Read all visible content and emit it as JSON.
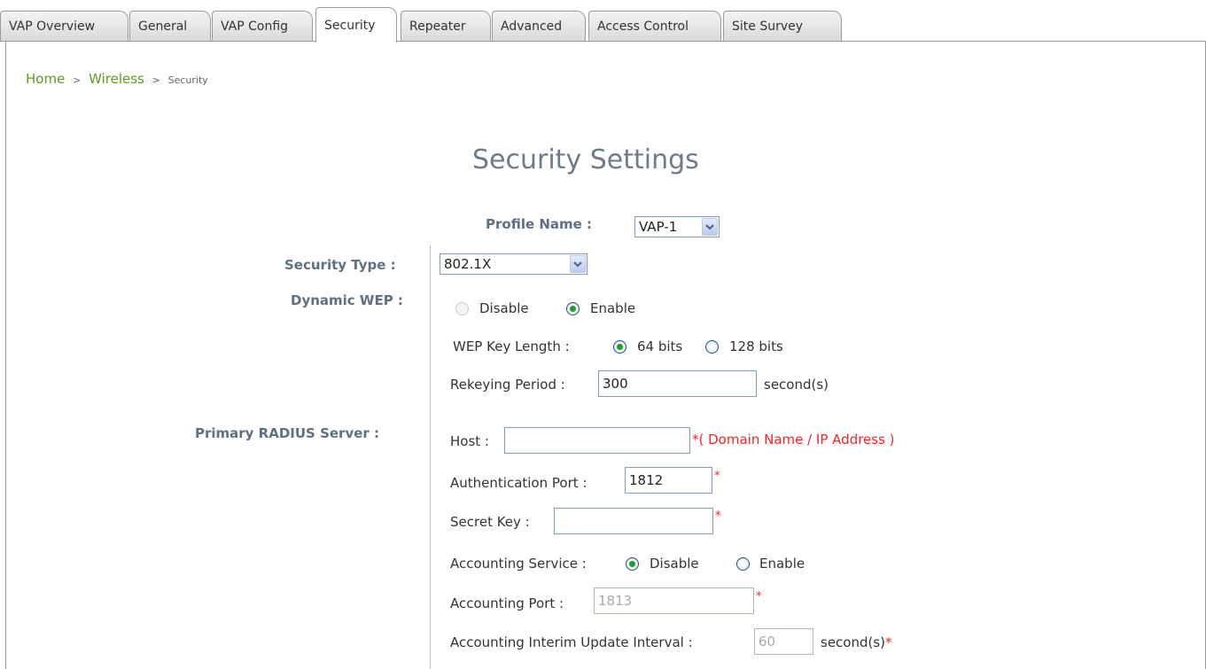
{
  "tabs": [
    {
      "label": "VAP Overview"
    },
    {
      "label": "General"
    },
    {
      "label": "VAP Config"
    },
    {
      "label": "Security"
    },
    {
      "label": "Repeater"
    },
    {
      "label": "Advanced"
    },
    {
      "label": "Access Control"
    },
    {
      "label": "Site Survey"
    }
  ],
  "breadcrumb": {
    "home": "Home",
    "sep": ">",
    "wireless": "Wireless",
    "current": "Security"
  },
  "page": {
    "title": "Security Settings"
  },
  "profile": {
    "label": "Profile Name :",
    "value": "VAP-1"
  },
  "security_type": {
    "label": "Security Type :",
    "value": "802.1X"
  },
  "dynamic_wep": {
    "label": "Dynamic WEP :",
    "disable": "Disable",
    "enable": "Enable",
    "selected": "Enable",
    "key_length_label": "WEP Key Length :",
    "key_64": "64 bits",
    "key_128": "128 bits",
    "key_selected": "64 bits",
    "rekey_label": "Rekeying Period :",
    "rekey_value": "300",
    "rekey_unit": "second(s)"
  },
  "radius": {
    "label": "Primary RADIUS Server :",
    "host_label": "Host :",
    "host_value": "",
    "required": "*",
    "host_hint": "( Domain Name / IP Address )",
    "auth_port_label": "Authentication Port :",
    "auth_port_value": "1812",
    "secret_label": "Secret Key :",
    "secret_value": "",
    "acct_service_label": "Accounting Service :",
    "acct_disable": "Disable",
    "acct_enable": "Enable",
    "acct_selected": "Disable",
    "acct_port_label": "Accounting Port :",
    "acct_port_value": "1813",
    "interim_label": "Accounting Interim Update Interval :",
    "interim_value": "60",
    "interim_unit": "second(s)"
  },
  "icons": {
    "dropdown": "chevron-down-icon"
  },
  "colors": {
    "label": "#5d7182",
    "title": "#6d7b8a",
    "link": "#5aa01e",
    "required": "#ff2222",
    "radio_dot": "#21a121"
  }
}
